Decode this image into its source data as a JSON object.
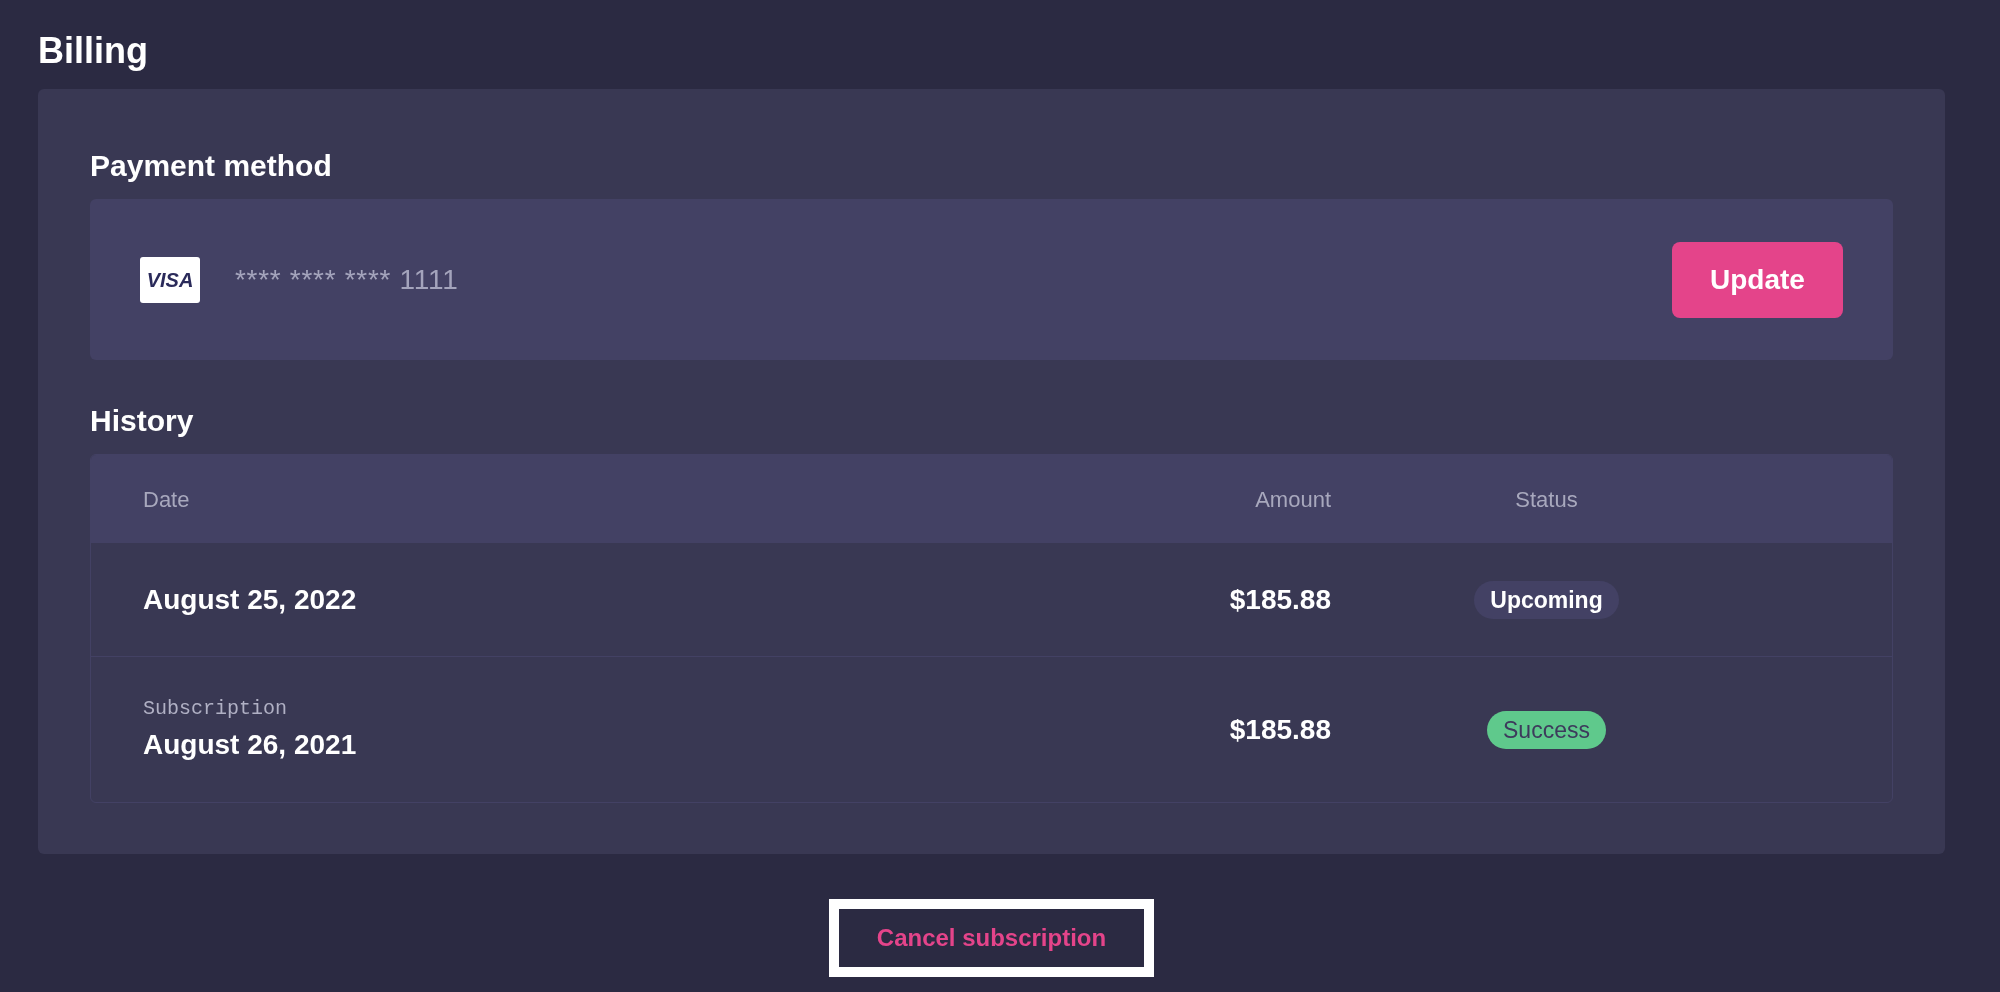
{
  "title": "Billing",
  "payment_method": {
    "heading": "Payment method",
    "card_brand": "VISA",
    "card_number": "**** **** **** 1111",
    "button": "Update"
  },
  "history": {
    "heading": "History",
    "columns": [
      "Date",
      "Amount",
      "Status"
    ],
    "rows": [
      {
        "caption": null,
        "date": "August 25, 2022",
        "amount": "$185.88",
        "status": {
          "label": "Upcoming",
          "kind": "upcoming"
        }
      },
      {
        "caption": "Subscription",
        "date": "August 26, 2021",
        "amount": "$185.88",
        "status": {
          "label": "Success",
          "kind": "success"
        }
      }
    ]
  },
  "cancel_button": "Cancel subscription"
}
